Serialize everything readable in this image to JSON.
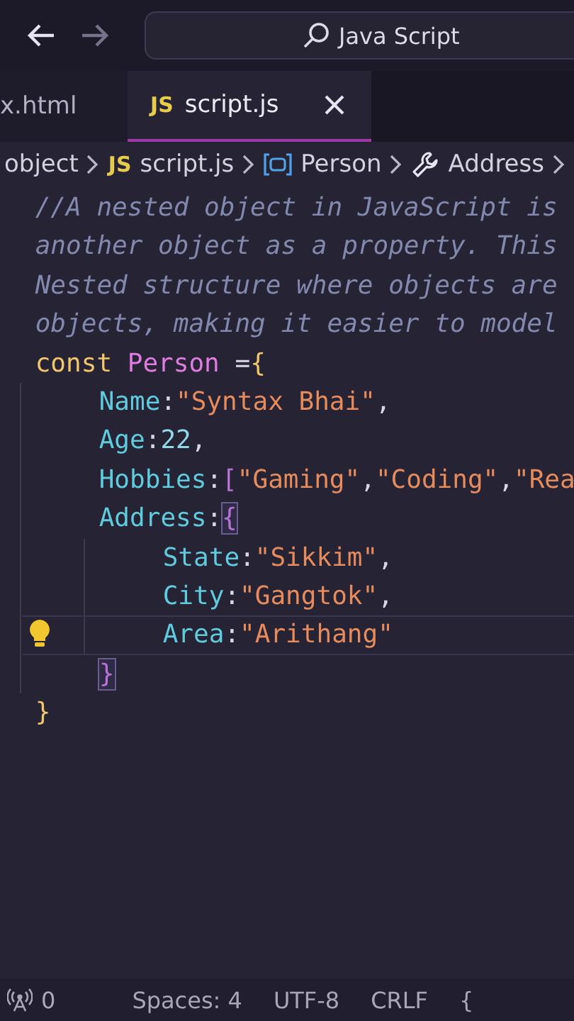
{
  "title_bar": {
    "search": "Java Script"
  },
  "tabs": [
    {
      "label": "x.html",
      "selected": false
    },
    {
      "label": "script.js",
      "badge": "JS",
      "selected": true
    }
  ],
  "breadcrumbs": [
    {
      "kind": "folder",
      "label": "object"
    },
    {
      "kind": "file",
      "badge": "JS",
      "label": "script.js"
    },
    {
      "kind": "variable",
      "label": "Person"
    },
    {
      "kind": "property",
      "label": "Address"
    }
  ],
  "code_lines": [
    {
      "current": false,
      "tokens": [
        {
          "kind": "comment",
          "text": "//A nested object in JavaScript is"
        }
      ]
    },
    {
      "current": false,
      "tokens": [
        {
          "kind": "comment",
          "text": "another object as a property. This"
        }
      ]
    },
    {
      "current": false,
      "tokens": [
        {
          "kind": "comment",
          "text": "Nested structure where objects are"
        }
      ]
    },
    {
      "current": false,
      "tokens": [
        {
          "kind": "comment",
          "text": "objects, making it easier to model"
        }
      ]
    },
    {
      "current": false,
      "tokens": [
        {
          "kind": "keyword",
          "text": "const"
        },
        {
          "kind": "variable",
          "text": "Person"
        },
        {
          "kind": "operator",
          "text": "="
        },
        {
          "kind": "brace",
          "text": "{"
        }
      ],
      "children": [
        {
          "current": false,
          "tokens": [
            {
              "kind": "property",
              "text": "Name"
            },
            {
              "kind": "punct",
              "text": ":"
            },
            {
              "kind": "string",
              "text": "\"Syntax Bhai\""
            },
            {
              "kind": "punct",
              "text": ","
            }
          ]
        },
        {
          "current": false,
          "tokens": [
            {
              "kind": "property",
              "text": "Age"
            },
            {
              "kind": "punct",
              "text": ":"
            },
            {
              "kind": "number",
              "text": "22"
            },
            {
              "kind": "punct",
              "text": ","
            }
          ]
        },
        {
          "current": false,
          "tokens": [
            {
              "kind": "property",
              "text": "Hobbies"
            },
            {
              "kind": "punct",
              "text": ":"
            },
            {
              "kind": "bracket",
              "text": "["
            },
            {
              "kind": "string",
              "text": "\"Gaming\""
            },
            {
              "kind": "punct",
              "text": ","
            },
            {
              "kind": "string",
              "text": "\"Coding\""
            },
            {
              "kind": "punct",
              "text": ","
            },
            {
              "kind": "string",
              "text": "\"Rea"
            }
          ]
        },
        {
          "current": false,
          "tokens": [
            {
              "kind": "property",
              "text": "Address"
            },
            {
              "kind": "punct",
              "text": ":"
            },
            {
              "kind": "matched_bracket",
              "text": "{"
            }
          ],
          "children": [
            {
              "current": false,
              "tokens": [
                {
                  "kind": "property",
                  "text": "State"
                },
                {
                  "kind": "punct",
                  "text": ":"
                },
                {
                  "kind": "string",
                  "text": "\"Sikkim\""
                },
                {
                  "kind": "punct",
                  "text": ","
                }
              ]
            },
            {
              "current": false,
              "tokens": [
                {
                  "kind": "property",
                  "text": "City"
                },
                {
                  "kind": "punct",
                  "text": ":"
                },
                {
                  "kind": "string",
                  "text": "\"Gangtok\""
                },
                {
                  "kind": "punct",
                  "text": ","
                }
              ]
            },
            {
              "current": true,
              "tokens": [
                {
                  "kind": "property",
                  "text": "Area"
                },
                {
                  "kind": "punct",
                  "text": ":"
                },
                {
                  "kind": "string",
                  "text": "\"Arithang\""
                }
              ]
            }
          ]
        },
        {
          "current": false,
          "tokens": [
            {
              "kind": "matched_bracket",
              "text": "}"
            }
          ]
        }
      ]
    },
    {
      "current": false,
      "tokens": [
        {
          "kind": "brace",
          "text": "}"
        }
      ]
    }
  ],
  "status_bar": {
    "ports": "0",
    "items": [
      "Spaces: 4",
      "UTF-8",
      "CRLF",
      "{"
    ]
  }
}
